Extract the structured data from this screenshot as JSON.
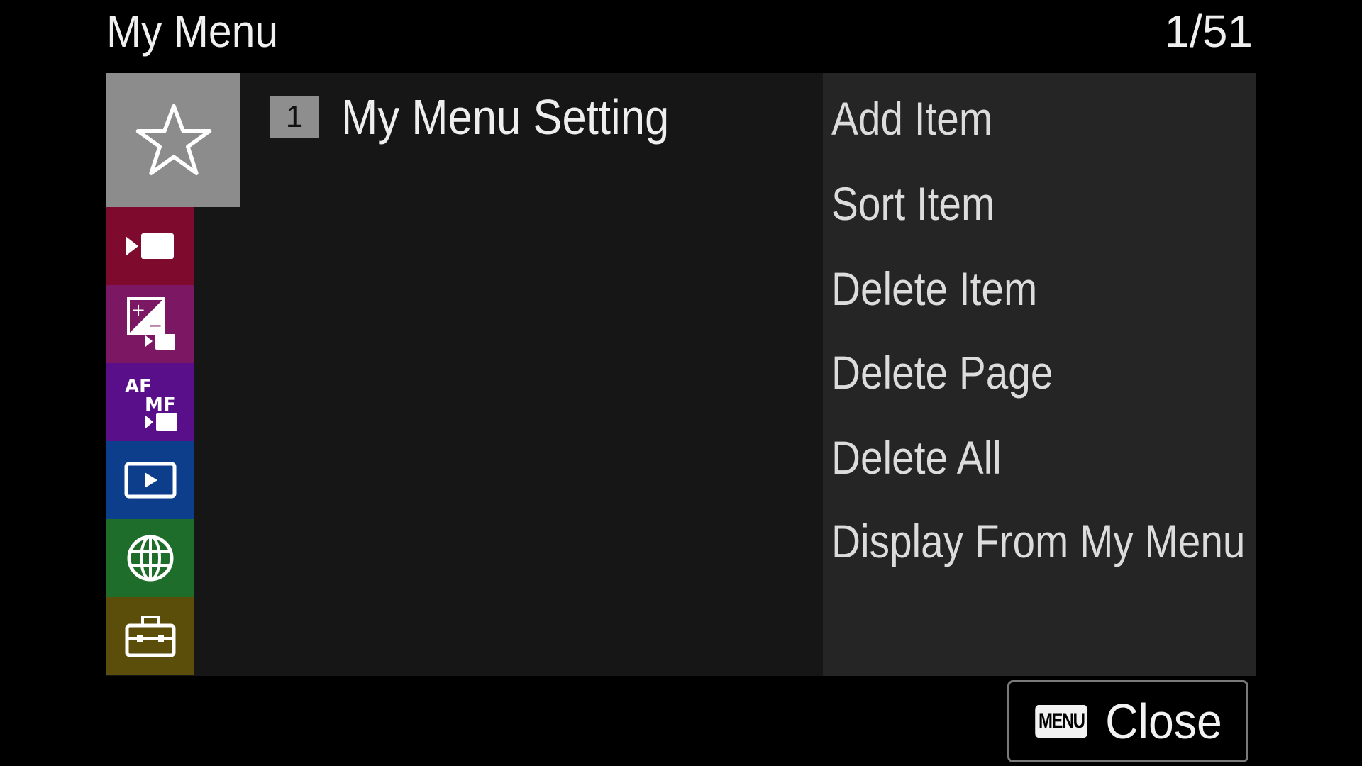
{
  "header": {
    "title": "My Menu",
    "page_indicator": "1/51"
  },
  "tabs": [
    {
      "name": "my-menu",
      "icon": "star-icon",
      "color": "#8c8c8c",
      "selected": true
    },
    {
      "name": "shooting",
      "icon": "movie-camera-icon",
      "color": "#7e0b2d"
    },
    {
      "name": "exposure-color",
      "icon": "exposure-icon",
      "color": "#7b1763"
    },
    {
      "name": "focus",
      "icon": "af-mf-icon",
      "color": "#5a0f8a"
    },
    {
      "name": "playback",
      "icon": "playback-icon",
      "color": "#0d3e8c"
    },
    {
      "name": "network",
      "icon": "globe-icon",
      "color": "#1f6d2a"
    },
    {
      "name": "setup",
      "icon": "toolbox-icon",
      "color": "#5b4e0b"
    }
  ],
  "submenu": {
    "page_number": "1",
    "label": "My Menu Setting"
  },
  "options": [
    "Add Item",
    "Sort Item",
    "Delete Item",
    "Delete Page",
    "Delete All",
    "Display From My Menu"
  ],
  "footer": {
    "menu_key": "MENU",
    "close_label": "Close"
  }
}
